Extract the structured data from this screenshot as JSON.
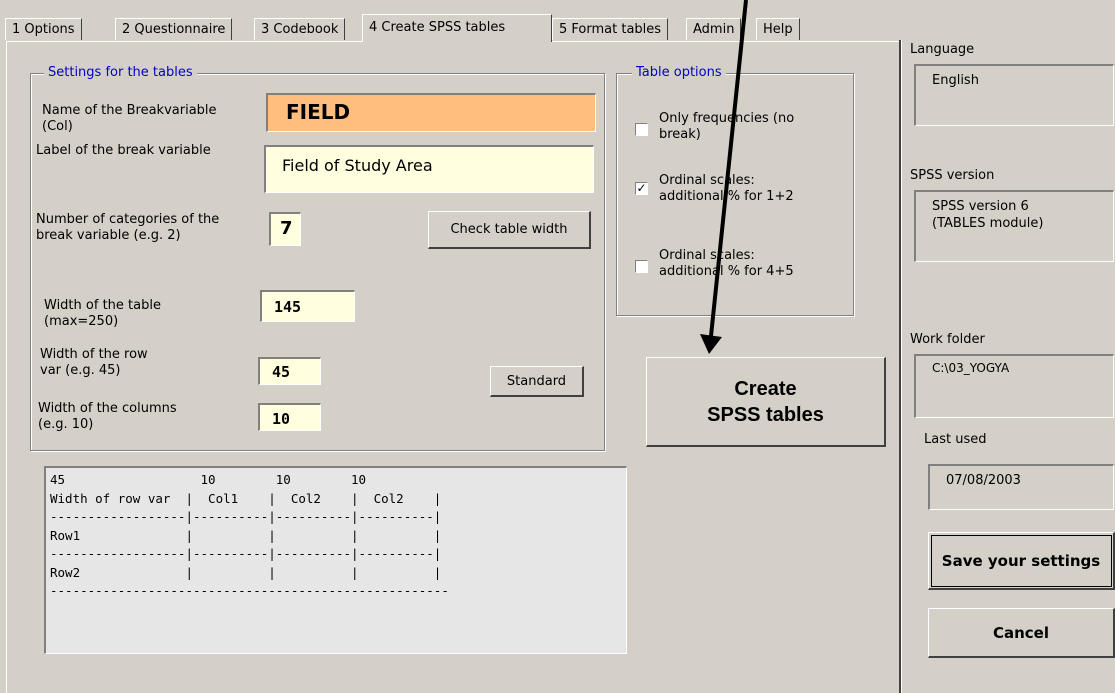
{
  "tabs": [
    "1 Options",
    "2 Questionnaire",
    "3 Codebook",
    "4 Create SPSS tables",
    "5 Format tables",
    "Admin",
    "Help"
  ],
  "settings": {
    "legend": "Settings for the tables",
    "breakvar_label": "Name of the Breakvariable\n(Col)",
    "breakvar_value": "FIELD",
    "breaklabel_label": "Label of the break variable",
    "breaklabel_value": "Field of Study Area",
    "ncat_label": "Number of categories of the\nbreak variable (e.g. 2)",
    "ncat_value": "7",
    "check_width_button": "Check table width",
    "table_width_label": "Width of the table\n(max=250)",
    "table_width_value": "145",
    "row_width_label": "Width of the row\nvar (e.g. 45)",
    "row_width_value": "45",
    "col_width_label": "Width of the columns\n(e.g. 10)",
    "col_width_value": "10",
    "standard_button": "Standard"
  },
  "table_options": {
    "legend": "Table options",
    "items": [
      {
        "label": "Only frequencies (no\nbreak)",
        "checked": false
      },
      {
        "label": "Ordinal scales:\nadditional % for 1+2",
        "checked": true
      },
      {
        "label": "Ordinal scales:\nadditional % for 4+5",
        "checked": false
      }
    ]
  },
  "create_button": "Create\nSPSS tables",
  "preview_text": "45                  10        10        10\nWidth of row var  |  Col1    |  Col2    |  Col2    |\n------------------|----------|----------|----------|\nRow1              |          |          |          |\n------------------|----------|----------|----------|\nRow2              |          |          |          |\n-----------------------------------------------------",
  "right_panel": {
    "language_label": "Language",
    "language_value": "English",
    "spss_label": "SPSS version",
    "spss_value": "SPSS version 6\n(TABLES module)",
    "work_label": "Work folder",
    "work_value": "C:\\03_YOGYA",
    "last_used_label": "Last used",
    "last_used_value": "07/08/2003",
    "save_button": "Save your settings",
    "cancel_button": "Cancel"
  },
  "colors": {
    "face": "#d4d0c8",
    "breakvar_bg": "#ffbe7e",
    "input_bg": "#ffffe0",
    "legend_blue": "#0000c8",
    "arrow": "#000000"
  }
}
